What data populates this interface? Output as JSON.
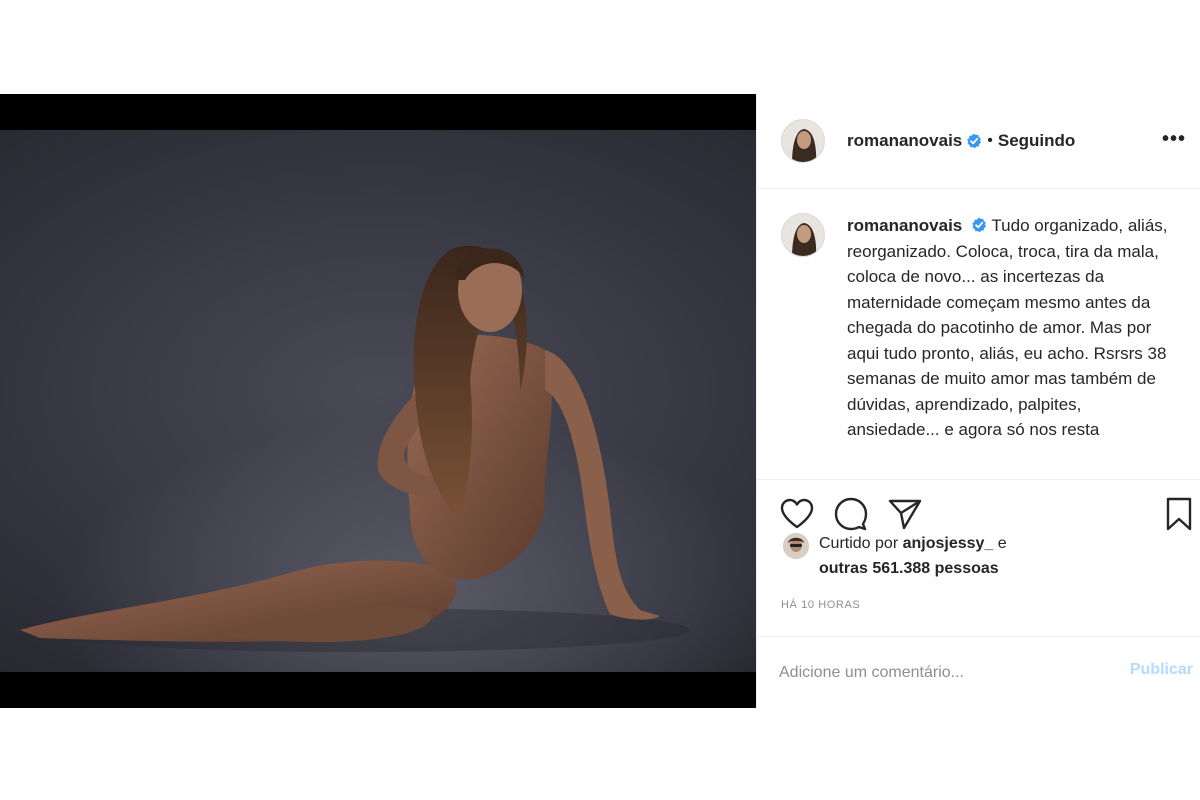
{
  "post": {
    "username": "romananovais",
    "separator": "•",
    "follow_status": "Seguindo",
    "more_label": "•••",
    "caption": "Tudo organizado, aliás, reorganizado. Coloca, troca, tira da mala, coloca de novo... as incertezas da maternidade começam mesmo antes da chegada do pacotinho de amor. Mas por aqui tudo pronto, aliás, eu acho. Rsrsrs 38 semanas de muito amor mas também de dúvidas, aprendizado, palpites, ansiedade... e agora só nos resta",
    "likes": {
      "prefix": "Curtido por",
      "liker": "anjosjessy_",
      "conjunction": "e",
      "others": "outras 561.388 pessoas"
    },
    "timestamp": "HÁ 10 HORAS",
    "comment": {
      "placeholder": "Adicione um comentário...",
      "publish_label": "Publicar"
    }
  },
  "colors": {
    "verified_badge": "#3897f0",
    "publish_disabled": "#b3dbff",
    "muted_text": "#8e8e8e",
    "divider": "#efefef"
  },
  "icons": {
    "like": "heart-icon",
    "comment": "comment-bubble-icon",
    "share": "paper-plane-icon",
    "save": "bookmark-icon",
    "verified": "verified-badge-icon"
  }
}
